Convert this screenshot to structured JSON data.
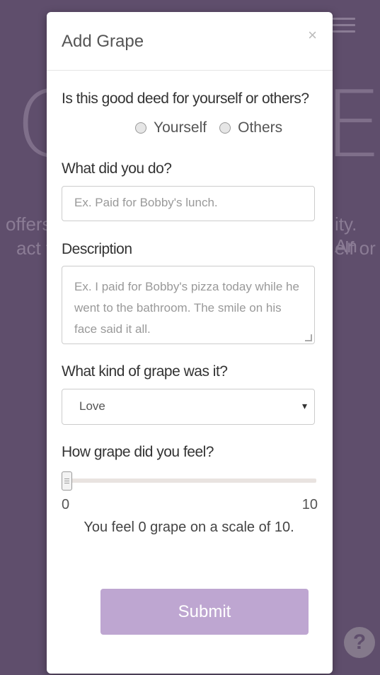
{
  "background": {
    "letter_left": "C",
    "letter_right": "E",
    "text_line1_left": "offers",
    "text_line2_left": "act t",
    "text_line1_right": "ity. An",
    "text_line2_right": "elf or"
  },
  "help_icon_glyph": "?",
  "modal": {
    "title": "Add Grape",
    "close_glyph": "×",
    "question_target": "Is this good deed for yourself or others?",
    "radio_yourself": "Yourself",
    "radio_others": "Others",
    "what_label": "What did you do?",
    "what_placeholder": "Ex. Paid for Bobby's lunch.",
    "description_label": "Description",
    "description_placeholder": "Ex. I paid for Bobby's pizza today while he went to the bathroom. The smile on his face said it all.",
    "kind_label": "What kind of grape was it?",
    "kind_selected": "Love",
    "kind_arrow": "▾",
    "feel_label": "How grape did you feel?",
    "slider_min": "0",
    "slider_max": "10",
    "slider_value": 0,
    "feel_text": "You feel 0 grape on a scale of 10.",
    "submit_label": "Submit"
  },
  "colors": {
    "backdrop": "#5f4e6c",
    "submit": "#bea6d1"
  }
}
